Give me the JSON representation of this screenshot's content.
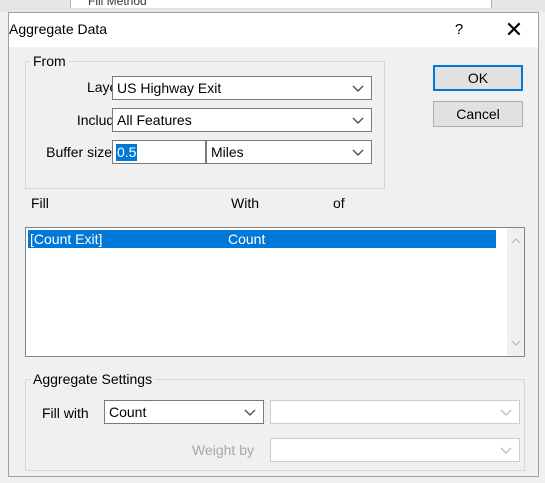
{
  "background_window": {
    "peek_text": "Fill Method"
  },
  "dialog": {
    "title": "Aggregate Data",
    "help_label": "?",
    "close_label": "✕"
  },
  "from_group": {
    "legend": "From",
    "layer_label": "Layer",
    "layer_value": "US Highway Exit",
    "include_label": "Include",
    "include_value": "All Features",
    "buffer_label": "Buffer size",
    "buffer_value": "0.5",
    "unit_value": "Miles"
  },
  "buttons": {
    "ok": "OK",
    "cancel": "Cancel"
  },
  "fill_list": {
    "headers": [
      "Fill",
      "With",
      "of"
    ],
    "rows": [
      {
        "fill": "[Count Exit]",
        "with": "Count",
        "of": ""
      }
    ]
  },
  "aggregate_settings": {
    "legend": "Aggregate Settings",
    "fill_with_label": "Fill with",
    "fill_with_value": "Count",
    "weight_by_label": "Weight by"
  },
  "colors": {
    "selection": "#0078d7",
    "dialog_bg": "#f0f0f0"
  }
}
